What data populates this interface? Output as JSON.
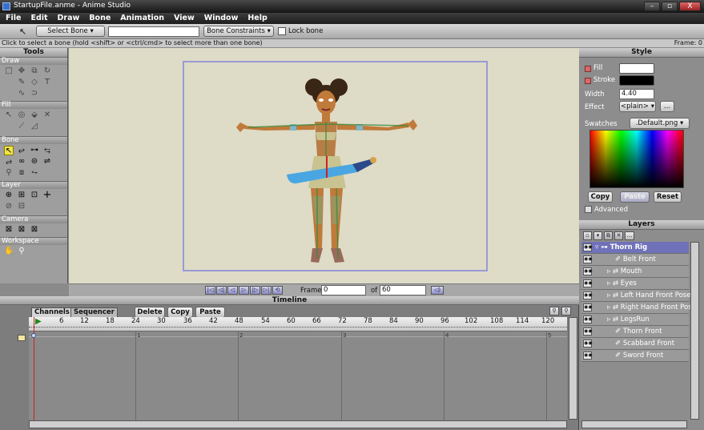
{
  "window": {
    "title": "StartupFile.anme - Anime Studio",
    "controls": [
      "–",
      "▫",
      "X"
    ]
  },
  "menu": [
    "File",
    "Edit",
    "Draw",
    "Bone",
    "Animation",
    "View",
    "Window",
    "Help"
  ],
  "toolbar": {
    "select_bone": "Select Bone",
    "bone_name_value": "",
    "bone_constraints": "Bone Constraints",
    "lock_bone": "Lock bone"
  },
  "hint": {
    "text": "Click to select a bone (hold <shift> or <ctrl/cmd> to select more than one bone)",
    "frame_label": "Frame: 0"
  },
  "tools": {
    "title": "Tools",
    "sections": [
      "Draw",
      "Fill",
      "Bone",
      "Layer",
      "Camera",
      "Workspace"
    ]
  },
  "playback": {
    "frame_label": "Frame",
    "frame_value": "0",
    "of_label": "of",
    "of_value": "60"
  },
  "timeline": {
    "title": "Timeline",
    "tabs": [
      "Channels",
      "Sequencer"
    ],
    "buttons": [
      "Delete",
      "Copy",
      "Paste"
    ],
    "ruler": [
      "6",
      "12",
      "18",
      "24",
      "30",
      "36",
      "42",
      "48",
      "54",
      "60",
      "66",
      "72",
      "78",
      "84",
      "90",
      "96",
      "102",
      "108",
      "114",
      "120"
    ],
    "seconds": [
      "1",
      "2",
      "3",
      "4",
      "5"
    ]
  },
  "style": {
    "title": "Style",
    "fill_label": "Fill",
    "stroke_label": "Stroke",
    "width_label": "Width",
    "width_value": "4.40",
    "effect_label": "Effect",
    "effect_value": "<plain>",
    "swatches_label": "Swatches",
    "swatches_value": ".Default.png",
    "copy": "Copy",
    "paste": "Paste",
    "reset": "Reset",
    "advanced": "Advanced",
    "fill_color": "#ffffff",
    "stroke_color": "#000000"
  },
  "layers": {
    "title": "Layers",
    "items": [
      {
        "name": "Thorn Rig",
        "kind": "bone-group"
      },
      {
        "name": "Belt Front",
        "kind": "vector"
      },
      {
        "name": "Mouth",
        "kind": "switch"
      },
      {
        "name": "Eyes",
        "kind": "switch"
      },
      {
        "name": "Left Hand Front Pose",
        "kind": "switch"
      },
      {
        "name": "Right Hand Front Pos",
        "kind": "switch"
      },
      {
        "name": "LegsRun",
        "kind": "switch"
      },
      {
        "name": "Thorn Front",
        "kind": "vector"
      },
      {
        "name": "Scabbard Front",
        "kind": "vector"
      },
      {
        "name": "Sword Front",
        "kind": "vector"
      }
    ]
  }
}
